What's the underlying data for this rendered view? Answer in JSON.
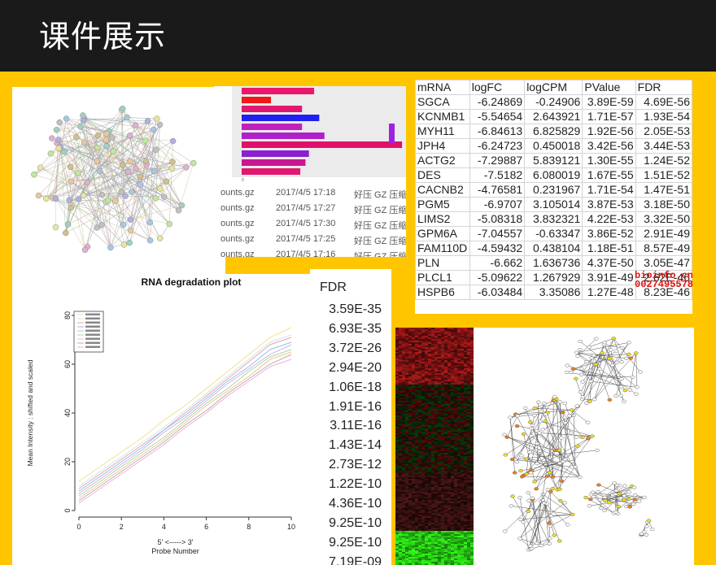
{
  "header": {
    "title": "课件展示"
  },
  "files": [
    {
      "name": "ounts.gz",
      "date": "2017/4/5 17:18",
      "type": "好压 GZ 压缩文"
    },
    {
      "name": "ounts.gz",
      "date": "2017/4/5 17:27",
      "type": "好压 GZ 压缩文"
    },
    {
      "name": "ounts.gz",
      "date": "2017/4/5 17:30",
      "type": "好压 GZ 压缩文"
    },
    {
      "name": "ounts.gz",
      "date": "2017/4/5 17:25",
      "type": "好压 GZ 压缩文"
    },
    {
      "name": "ounts.gz",
      "date": "2017/4/5 17:16",
      "type": "好压 GZ 压缩文"
    }
  ],
  "deg_table": {
    "headers": [
      "mRNA",
      "logFC",
      "logCPM",
      "PValue",
      "FDR"
    ],
    "rows": [
      [
        "SGCA",
        "-6.24869",
        "-0.24906",
        "3.89E-59",
        "4.69E-56"
      ],
      [
        "KCNMB1",
        "-5.54654",
        "2.643921",
        "1.71E-57",
        "1.93E-54"
      ],
      [
        "MYH11",
        "-6.84613",
        "6.825829",
        "1.92E-56",
        "2.05E-53"
      ],
      [
        "JPH4",
        "-6.24723",
        "0.450018",
        "3.42E-56",
        "3.44E-53"
      ],
      [
        "ACTG2",
        "-7.29887",
        "5.839121",
        "1.30E-55",
        "1.24E-52"
      ],
      [
        "DES",
        "-7.5182",
        "6.080019",
        "1.67E-55",
        "1.51E-52"
      ],
      [
        "CACNB2",
        "-4.76581",
        "0.231967",
        "1.71E-54",
        "1.47E-51"
      ],
      [
        "PGM5",
        "-6.9707",
        "3.105014",
        "3.87E-53",
        "3.18E-50"
      ],
      [
        "LIMS2",
        "-5.08318",
        "3.832321",
        "4.22E-53",
        "3.32E-50"
      ],
      [
        "GPM6A",
        "-7.04557",
        "-0.63347",
        "3.86E-52",
        "2.91E-49"
      ],
      [
        "FAM110D",
        "-4.59432",
        "0.438104",
        "1.18E-51",
        "8.57E-49"
      ],
      [
        "PLN",
        "-6.662",
        "1.636736",
        "4.37E-50",
        "3.05E-47"
      ],
      [
        "PLCL1",
        "-5.09622",
        "1.267929",
        "3.91E-49",
        "2.62E-46"
      ],
      [
        "HSPB6",
        "-6.03484",
        "3.35086",
        "1.27E-48",
        "8.23E-46"
      ]
    ]
  },
  "watermark": {
    "line1": "bioinfo.cn",
    "line2": "00274955788"
  },
  "fdr_column": {
    "header": "FDR",
    "values": [
      "3.59E-35",
      "6.93E-35",
      "3.72E-26",
      "2.94E-20",
      "1.06E-18",
      "1.91E-16",
      "3.11E-16",
      "1.43E-14",
      "2.73E-12",
      "1.22E-10",
      "4.36E-10",
      "9.25E-10",
      "9.25E-10",
      "7.19E-09"
    ]
  },
  "chart_data": [
    {
      "type": "line",
      "title": "RNA degradation plot",
      "xlabel": "5' <-----> 3'\nProbe Number",
      "xlabel_line1": "5' <-----> 3'",
      "xlabel_line2": "Probe Number",
      "ylabel": "Mean Intensity : shifted and scaled",
      "xlim": [
        0,
        10
      ],
      "ylim": [
        0,
        80
      ],
      "x_ticks": [
        0,
        2,
        4,
        6,
        8,
        10
      ],
      "y_ticks": [
        0,
        20,
        40,
        60,
        80
      ],
      "x": [
        0,
        1,
        2,
        3,
        4,
        5,
        6,
        7,
        8,
        9,
        10
      ],
      "series": [
        {
          "color": "#f4e08a",
          "values": [
            12,
            18,
            24,
            30,
            37,
            43,
            50,
            57,
            64,
            71,
            75
          ]
        },
        {
          "color": "#c8e6f5",
          "values": [
            10,
            16,
            22,
            28,
            34,
            41,
            48,
            55,
            62,
            69,
            72
          ]
        },
        {
          "color": "#f0a0a0",
          "values": [
            9,
            15,
            21,
            27,
            33,
            40,
            47,
            54,
            61,
            68,
            71
          ]
        },
        {
          "color": "#90c0e8",
          "values": [
            8,
            14,
            20,
            26,
            33,
            39,
            46,
            53,
            59,
            66,
            69
          ]
        },
        {
          "color": "#d0b0e8",
          "values": [
            7,
            13,
            19,
            25,
            32,
            38,
            45,
            52,
            58,
            64,
            68
          ]
        },
        {
          "color": "#a8d8a0",
          "values": [
            6,
            12,
            18,
            24,
            30,
            37,
            44,
            50,
            57,
            63,
            66
          ]
        },
        {
          "color": "#f8c090",
          "values": [
            5,
            11,
            17,
            23,
            29,
            36,
            43,
            49,
            55,
            62,
            65
          ]
        },
        {
          "color": "#b0b0b0",
          "values": [
            4,
            10,
            16,
            22,
            28,
            35,
            41,
            48,
            54,
            60,
            64
          ]
        },
        {
          "color": "#f0b0d8",
          "values": [
            3,
            9,
            15,
            21,
            27,
            34,
            40,
            47,
            53,
            59,
            62
          ]
        }
      ]
    },
    {
      "type": "bar",
      "orientation": "horizontal",
      "x_ticks": [
        "0",
        "",
        "",
        "",
        ""
      ],
      "values": [
        4.2,
        1.7,
        3.5,
        4.5,
        3.5,
        4.8,
        9.3,
        3.9,
        3.7,
        3.4
      ],
      "colors": [
        "#e8186a",
        "#f01818",
        "#e01870",
        "#2020f0",
        "#c020c0",
        "#b020c8",
        "#e0106a",
        "#8a20d0",
        "#c81890",
        "#e0186e"
      ],
      "xlim": [
        0,
        10
      ]
    }
  ]
}
